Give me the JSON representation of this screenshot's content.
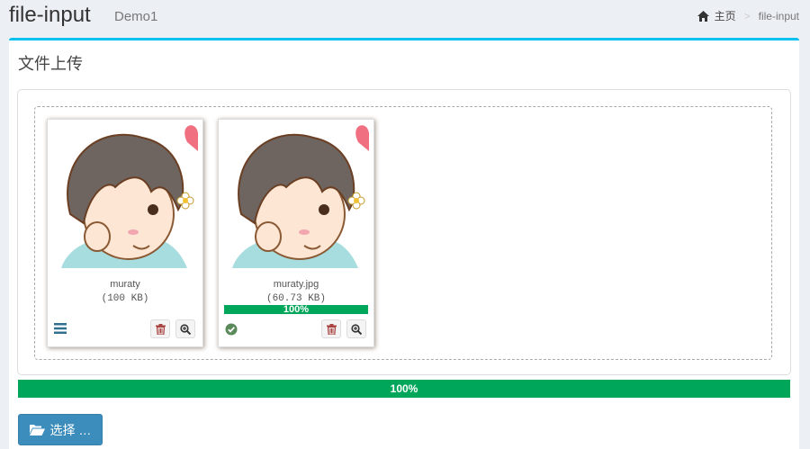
{
  "header": {
    "title": "file-input",
    "subtitle": "Demo1"
  },
  "breadcrumb": {
    "home_icon": "home-icon",
    "home": "主页",
    "separator": ">",
    "current": "file-input"
  },
  "box": {
    "title": "文件上传",
    "accent_color": "#00c0ef"
  },
  "previews": [
    {
      "name": "muraty",
      "size": "(100 KB)",
      "progress_label": "",
      "progress": null,
      "status_icon": "drag-handle-icon",
      "image": "cartoon-boy-avatar"
    },
    {
      "name": "muraty.jpg",
      "size": "(60.73 KB)",
      "progress_label": "100%",
      "progress": 1.0,
      "status_icon": "success-check-icon",
      "image": "cartoon-boy-avatar"
    }
  ],
  "actions": {
    "delete_icon": "trash-icon",
    "zoom_icon": "zoom-in-icon"
  },
  "main_progress": {
    "label": "100%",
    "value": 1.0,
    "color": "#00a65a"
  },
  "browse_button": {
    "label": "选择 …",
    "icon": "folder-open-icon",
    "color": "#3c8dbc"
  }
}
